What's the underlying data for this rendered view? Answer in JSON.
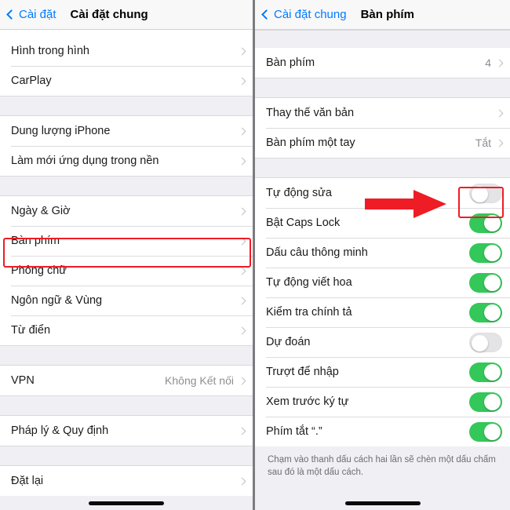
{
  "colors": {
    "accent_blue": "#007aff",
    "toggle_on_green": "#34c759",
    "toggle_off_gray": "#e4e4e6",
    "highlight_red": "#ee1c25",
    "group_bg": "#efeff4",
    "row_bg": "#ffffff",
    "secondary_text": "#8e8e93"
  },
  "left_panel": {
    "nav": {
      "back_label": "Cài đặt",
      "title": "Cài đặt chung",
      "back_icon": "chevron-left-icon"
    },
    "sections": [
      {
        "rows": [
          {
            "label": "Hình trong hình",
            "value": "",
            "accessory": "chevron-right-icon"
          },
          {
            "label": "CarPlay",
            "value": "",
            "accessory": "chevron-right-icon"
          }
        ]
      },
      {
        "rows": [
          {
            "label": "Dung lượng iPhone",
            "value": "",
            "accessory": "chevron-right-icon"
          },
          {
            "label": "Làm mới ứng dụng trong nền",
            "value": "",
            "accessory": "chevron-right-icon"
          }
        ]
      },
      {
        "rows": [
          {
            "label": "Ngày & Giờ",
            "value": "",
            "accessory": "chevron-right-icon"
          },
          {
            "label": "Bàn phím",
            "value": "",
            "accessory": "chevron-right-icon",
            "highlighted": true
          },
          {
            "label": "Phông chữ",
            "value": "",
            "accessory": "chevron-right-icon"
          },
          {
            "label": "Ngôn ngữ & Vùng",
            "value": "",
            "accessory": "chevron-right-icon"
          },
          {
            "label": "Từ điển",
            "value": "",
            "accessory": "chevron-right-icon"
          }
        ]
      },
      {
        "rows": [
          {
            "label": "VPN",
            "value": "Không Kết nối",
            "accessory": "chevron-right-icon"
          }
        ]
      },
      {
        "rows": [
          {
            "label": "Pháp lý & Quy định",
            "value": "",
            "accessory": "chevron-right-icon"
          }
        ]
      },
      {
        "rows": [
          {
            "label": "Đặt lại",
            "value": "",
            "accessory": "chevron-right-icon"
          }
        ]
      }
    ]
  },
  "right_panel": {
    "nav": {
      "back_label": "Cài đặt chung",
      "title": "Bàn phím",
      "back_icon": "chevron-left-icon"
    },
    "sections": [
      {
        "rows": [
          {
            "label": "Bàn phím",
            "value": "4",
            "accessory": "chevron-right-icon"
          }
        ]
      },
      {
        "rows": [
          {
            "label": "Thay thế văn bản",
            "value": "",
            "accessory": "chevron-right-icon"
          },
          {
            "label": "Bàn phím một tay",
            "value": "Tắt",
            "accessory": "chevron-right-icon"
          }
        ]
      },
      {
        "rows": [
          {
            "label": "Tự động sửa",
            "accessory": "toggle",
            "toggle": "off",
            "highlighted": true
          },
          {
            "label": "Bật Caps Lock",
            "accessory": "toggle",
            "toggle": "on"
          },
          {
            "label": "Dấu câu thông minh",
            "accessory": "toggle",
            "toggle": "on"
          },
          {
            "label": "Tự động viết hoa",
            "accessory": "toggle",
            "toggle": "on"
          },
          {
            "label": "Kiểm tra chính tả",
            "accessory": "toggle",
            "toggle": "on"
          },
          {
            "label": "Dự đoán",
            "accessory": "toggle",
            "toggle": "off"
          },
          {
            "label": "Trượt để nhập",
            "accessory": "toggle",
            "toggle": "on"
          },
          {
            "label": "Xem trước ký tự",
            "accessory": "toggle",
            "toggle": "on"
          },
          {
            "label": "Phím tắt “.”",
            "accessory": "toggle",
            "toggle": "on"
          }
        ]
      }
    ],
    "footer_note": "Chạm vào thanh dấu cách hai lần sẽ chèn một dấu chấm sau đó là một dấu cách."
  },
  "annotations": {
    "arrow_icon": "red-right-arrow-icon",
    "arrow_color": "#ee1c25",
    "highlight_box_color": "#ee1c25"
  }
}
